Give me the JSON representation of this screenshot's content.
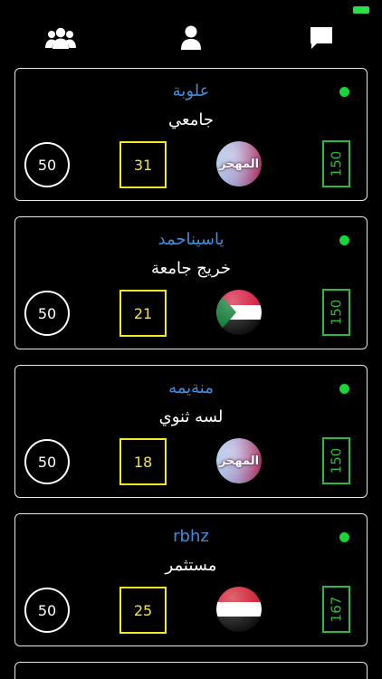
{
  "nav": {
    "items": [
      {
        "icon": "users-icon"
      },
      {
        "icon": "user-icon"
      },
      {
        "icon": "chat-icon"
      }
    ]
  },
  "colors": {
    "background": "#000000",
    "name": "#3d8fe0",
    "online": "#17d636",
    "score_box": "#f5e82b",
    "points_box": "#2eb83c"
  },
  "cards": [
    {
      "name": "علوبة",
      "education": "جامعي",
      "circle_value": "50",
      "box_value": "31",
      "flag_text": "المهجر",
      "flag_type": "mahjar",
      "points": "150"
    },
    {
      "name": "ياسيناحمد",
      "education": "خريج جامعة",
      "circle_value": "50",
      "box_value": "21",
      "flag_text": "",
      "flag_type": "sudan",
      "points": "150"
    },
    {
      "name": "منةيمه",
      "education": "لسه ثنوي",
      "circle_value": "50",
      "box_value": "18",
      "flag_text": "المهجر",
      "flag_type": "mahjar",
      "points": "150"
    },
    {
      "name": "rbhz",
      "education": "مستثمر",
      "circle_value": "50",
      "box_value": "25",
      "flag_text": "",
      "flag_type": "yemen",
      "points": "167"
    }
  ]
}
